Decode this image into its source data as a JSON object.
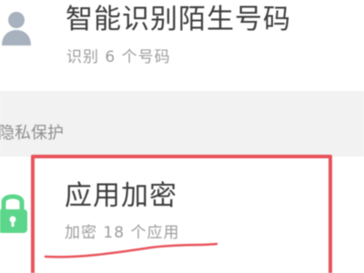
{
  "rows": [
    {
      "title": "智能识别陌生号码",
      "subtitle": "识别 6 个号码",
      "icon": "person-icon"
    },
    {
      "title": "应用加密",
      "subtitle": "加密 18 个应用",
      "icon": "lock-icon"
    }
  ],
  "section": {
    "title": "隐私保护"
  },
  "colors": {
    "lock_icon": "#5cd68a",
    "person_icon": "#a8b2bf",
    "annotation": "#e8545c",
    "section_band": "#f2f2f2"
  }
}
